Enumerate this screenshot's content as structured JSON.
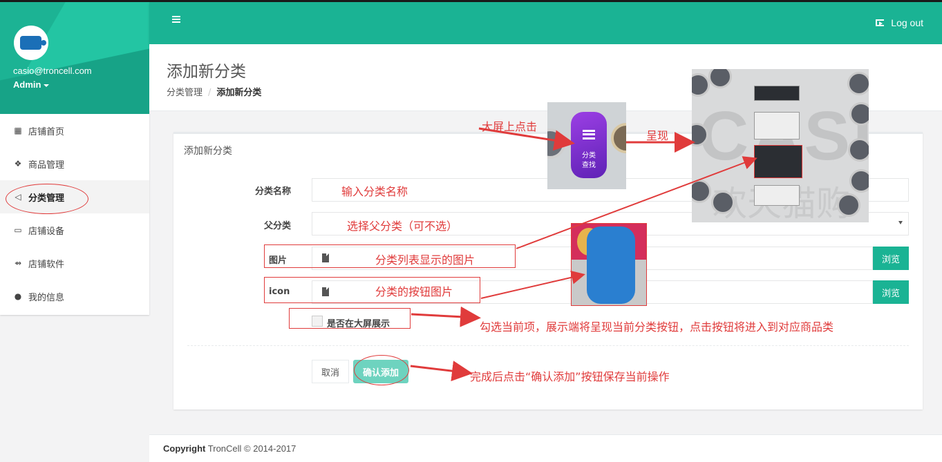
{
  "app": {
    "user_email": "casio@troncell.com",
    "user_role": "Admin"
  },
  "sidebar": {
    "items": [
      {
        "label": "店铺首页",
        "icon": "dashboard-icon"
      },
      {
        "label": "商品管理",
        "icon": "cubes-icon"
      },
      {
        "label": "分类管理",
        "icon": "bullhorn-icon",
        "active": true
      },
      {
        "label": "店铺设备",
        "icon": "laptop-icon"
      },
      {
        "label": "店铺软件",
        "icon": "usb-icon"
      },
      {
        "label": "我的信息",
        "icon": "user-icon"
      }
    ]
  },
  "topbar": {
    "logout_label": "Log out"
  },
  "page": {
    "title": "添加新分类",
    "breadcrumb": [
      "分类管理",
      "添加新分类"
    ]
  },
  "form": {
    "card_title": "添加新分类",
    "name_label": "分类名称",
    "parent_label": "父分类",
    "image_label": "图片",
    "icon_label": "icon",
    "browse_label": "浏览",
    "bigscreen_label": "是否在大屏展示",
    "cancel_label": "取消",
    "confirm_label": "确认添加"
  },
  "annotations": {
    "click_on_screen": "大屏上点击",
    "shows": "呈现",
    "enter_name": "输入分类名称",
    "choose_parent": "选择父分类（可不选）",
    "list_image": "分类列表显示的图片",
    "button_image": "分类的按钮图片",
    "checkbox_note": "勾选当前项，展示端将呈现当前分类按钮，点击按钮将进入到对应商品类",
    "confirm_note": "完成后点击“确认添加”按钮保存当前操作",
    "pill_line1": "分类",
    "pill_line2": "查找",
    "screen_brand": "CASIO",
    "screen_cn": "欢天猫购"
  },
  "footer": {
    "copyright_bold": "Copyright",
    "copyright_rest": "TronCell © 2014-2017"
  },
  "colors": {
    "accent": "#1ab394",
    "annotation": "#e03b3b",
    "confirm_button": "#6ed3bf"
  }
}
